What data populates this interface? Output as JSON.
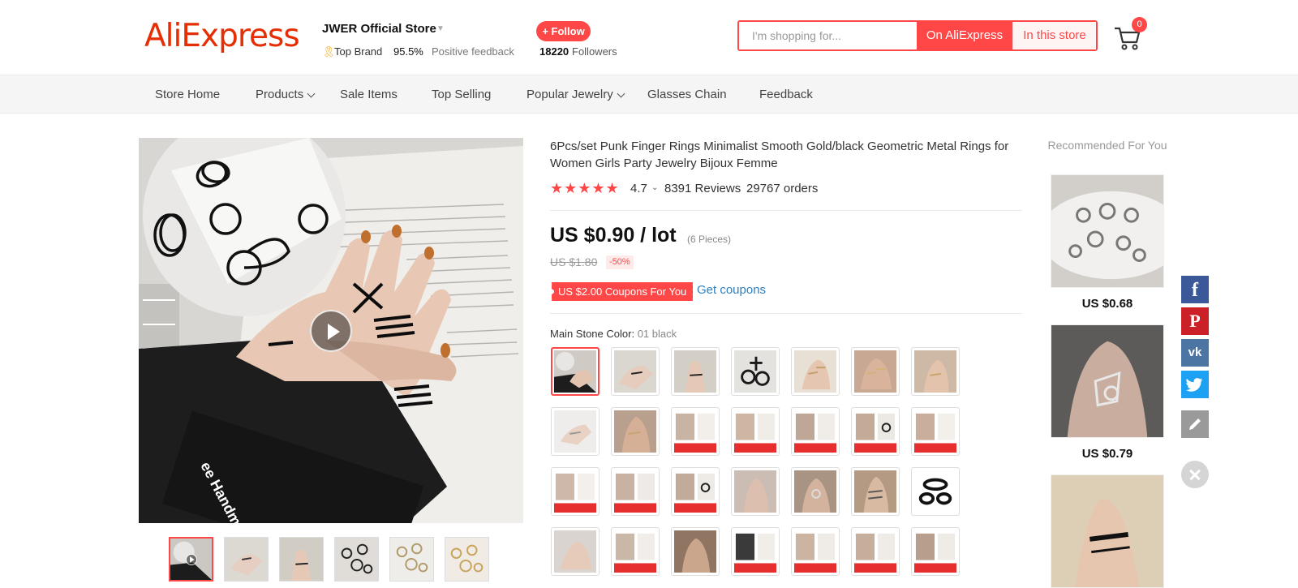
{
  "header": {
    "logo": "AliExpress",
    "store_name": "JWER Official Store",
    "top_brand": "Top Brand",
    "feedback_pct": "95.5%",
    "feedback_label": "Positive feedback",
    "follow_label": "+ Follow",
    "followers_count": "18220",
    "followers_label": "Followers",
    "search_placeholder": "I'm shopping for...",
    "search_ali_label": "On AliExpress",
    "search_store_label": "In this store",
    "cart_count": "0"
  },
  "nav": {
    "items": [
      "Store Home",
      "Products",
      "Sale Items",
      "Top Selling",
      "Popular Jewelry",
      "Glasses Chain",
      "Feedback"
    ]
  },
  "product": {
    "title": "6Pcs/set Punk Finger Rings Minimalist Smooth Gold/black Geometric Metal Rings for Women Girls Party Jewelry Bijoux Femme",
    "stars": "★★★★★",
    "rating": "4.7",
    "reviews": "8391 Reviews",
    "orders": "29767 orders",
    "price": "US $0.90 / lot",
    "price_unit": "(6 Pieces)",
    "old_price": "US $1.80",
    "discount": "-50%",
    "coupon": "US $2.00 Coupons For You",
    "get_coupons": "Get coupons",
    "color_label": "Main Stone Color:",
    "color_value": "01 black"
  },
  "recommended": {
    "title": "Recommended For You",
    "items": [
      {
        "price": "US $0.68"
      },
      {
        "price": "US $0.79"
      }
    ]
  },
  "colors": {
    "accent": "#ff4747",
    "logo": "#e62e04",
    "link": "#2e7fc1"
  },
  "social": [
    "facebook-icon",
    "pinterest-icon",
    "vk-icon",
    "twitter-icon",
    "edit-icon"
  ]
}
